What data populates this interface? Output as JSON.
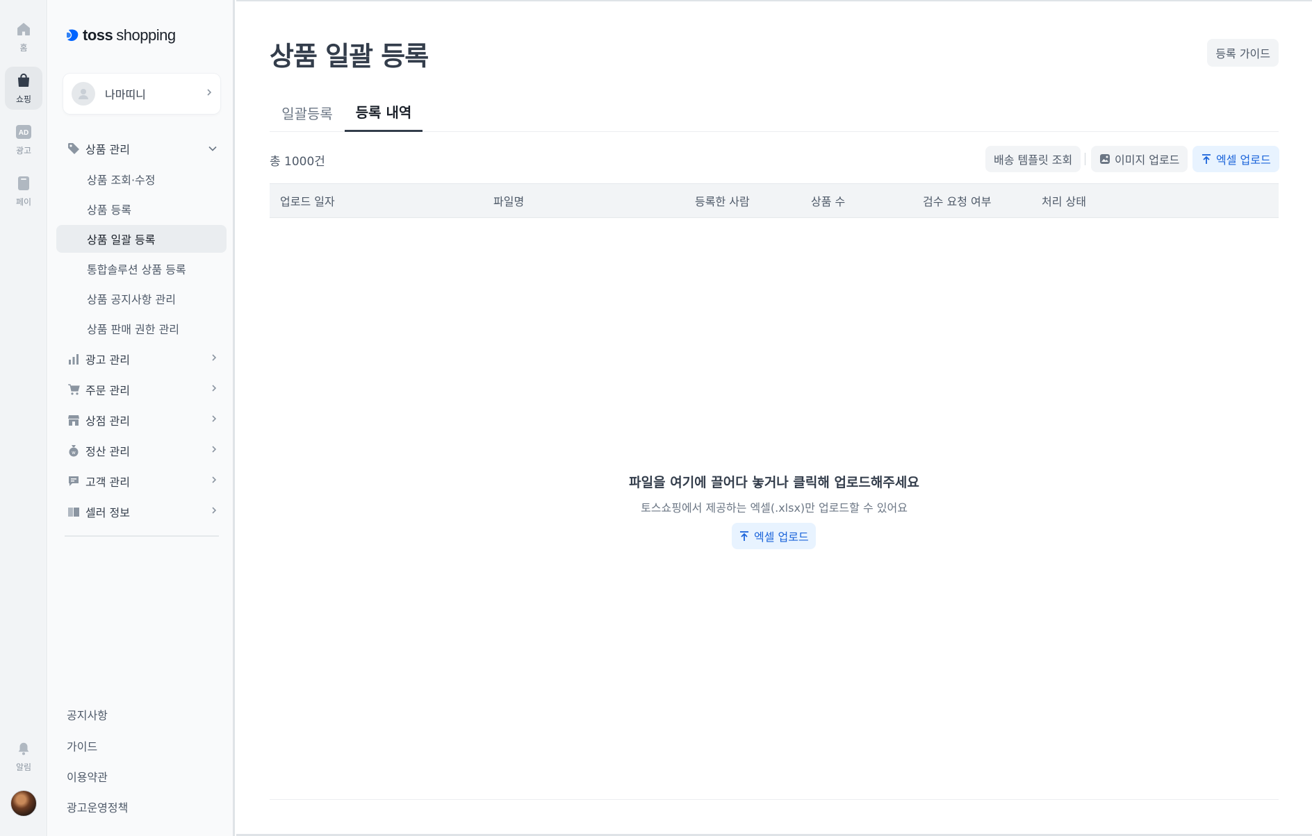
{
  "rail": {
    "items": [
      {
        "label": "홈",
        "icon": "home-icon"
      },
      {
        "label": "쇼핑",
        "icon": "shopping-bag-icon"
      },
      {
        "label": "광고",
        "icon": "ad-icon"
      },
      {
        "label": "페이",
        "icon": "pay-card-icon"
      },
      {
        "label": "알림",
        "icon": "bell-icon"
      }
    ],
    "ad_badge": "AD"
  },
  "logo": {
    "word1": "toss",
    "word2": "shopping"
  },
  "store": {
    "name": "나마띠니"
  },
  "sidebar": {
    "product_group": "상품 관리",
    "product_sub": [
      "상품 조회·수정",
      "상품 등록",
      "상품 일괄 등록",
      "통합솔루션 상품 등록",
      "상품 공지사항 관리",
      "상품 판매 권한 관리"
    ],
    "groups": [
      {
        "label": "광고 관리",
        "icon": "bar-chart-icon"
      },
      {
        "label": "주문 관리",
        "icon": "cart-icon"
      },
      {
        "label": "상점 관리",
        "icon": "store-icon"
      },
      {
        "label": "정산 관리",
        "icon": "money-bag-icon"
      },
      {
        "label": "고객 관리",
        "icon": "chat-bubble-icon"
      },
      {
        "label": "셀러 정보",
        "icon": "id-card-icon"
      }
    ],
    "footer": [
      "공지사항",
      "가이드",
      "이용약관",
      "광고운영정책"
    ]
  },
  "main": {
    "title": "상품 일괄 등록",
    "guide_button": "등록 가이드",
    "tabs": [
      {
        "label": "일괄등록",
        "active": false
      },
      {
        "label": "등록 내역",
        "active": true
      }
    ],
    "total": "총 1000건",
    "actions": {
      "shipping_template": "배송 템플릿 조회",
      "image_upload": "이미지 업로드",
      "excel_upload": "엑셀 업로드"
    },
    "table": {
      "columns": [
        "업로드 일자",
        "파일명",
        "등록한 사람",
        "상품 수",
        "검수 요청 여부",
        "처리 상태"
      ]
    },
    "empty": {
      "title": "파일을 여기에 끌어다 놓거나 클릭해 업로드해주세요",
      "subtitle": "토스쇼핑에서 제공하는 엑셀(.xlsx)만 업로드할 수 있어요",
      "button": "엑셀 업로드"
    }
  },
  "colors": {
    "brand_blue": "#3182f6",
    "accent_text_blue": "#1b64da",
    "accent_bg_blue": "#e8f3ff"
  }
}
